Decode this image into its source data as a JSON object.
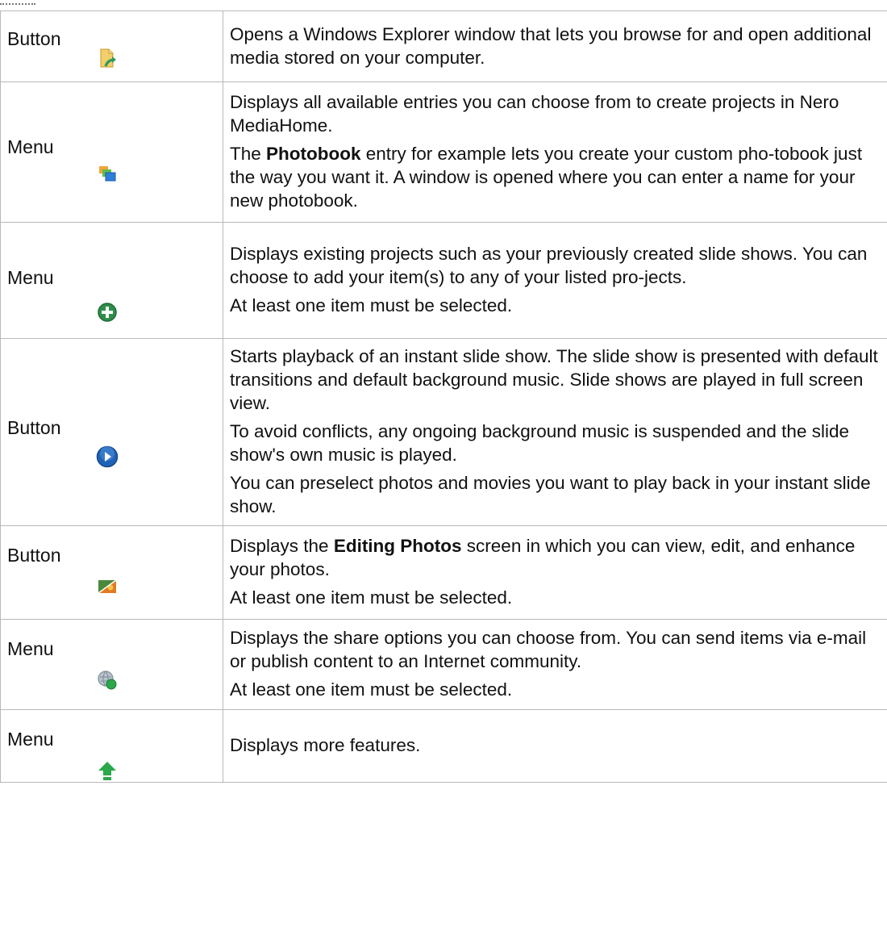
{
  "rows": [
    {
      "type": "Button",
      "icon": "open-folder-icon",
      "paragraphs": [
        [
          "Opens a Windows Explorer window that lets you browse for and open additional media stored on your computer."
        ]
      ]
    },
    {
      "type": "Menu",
      "icon": "create-project-icon",
      "paragraphs": [
        [
          "Displays all available entries you can choose from to create projects in Nero MediaHome."
        ],
        [
          "The ",
          "Photobook",
          " entry for example lets you create your custom pho-tobook just the way you want it. A window is opened where you can enter a name for your new photobook."
        ]
      ]
    },
    {
      "type": "Menu",
      "icon": "add-to-project-icon",
      "paragraphs": [
        [
          "Displays existing projects such as your previously created slide shows. You can choose to add your item(s) to any of your listed pro-jects."
        ],
        [
          "At least one item must be selected."
        ]
      ]
    },
    {
      "type": "Button",
      "icon": "play-icon",
      "paragraphs": [
        [
          "Starts playback of an instant slide show. The slide show is presented with default transitions and default background music. Slide shows are played in full screen view."
        ],
        [
          "To avoid conflicts, any ongoing background music is suspended and the slide show's own music is played."
        ],
        [
          "You can preselect photos and movies you want to play back in your instant slide show."
        ]
      ]
    },
    {
      "type": "Button",
      "icon": "edit-photos-icon",
      "paragraphs": [
        [
          "Displays the ",
          "Editing Photos",
          " screen in which you can view, edit, and enhance your photos."
        ],
        [
          "At least one item must be selected."
        ]
      ]
    },
    {
      "type": "Menu",
      "icon": "share-icon",
      "paragraphs": [
        [
          "Displays the share options you can choose from. You can send items via e-mail or publish content to an Internet community."
        ],
        [
          "At least one item must be selected."
        ]
      ]
    },
    {
      "type": "Menu",
      "icon": "more-features-arrow-icon",
      "paragraphs": [
        [
          "Displays more features."
        ]
      ]
    }
  ],
  "colors": {
    "border": "#b9b9b9",
    "text": "#111111",
    "folder": "#f2cf6b",
    "play_blue": "#1f63b8",
    "plus_green": "#2f8f4a",
    "arrow_green": "#2aa84a",
    "photo_orange": "#e07a24"
  }
}
